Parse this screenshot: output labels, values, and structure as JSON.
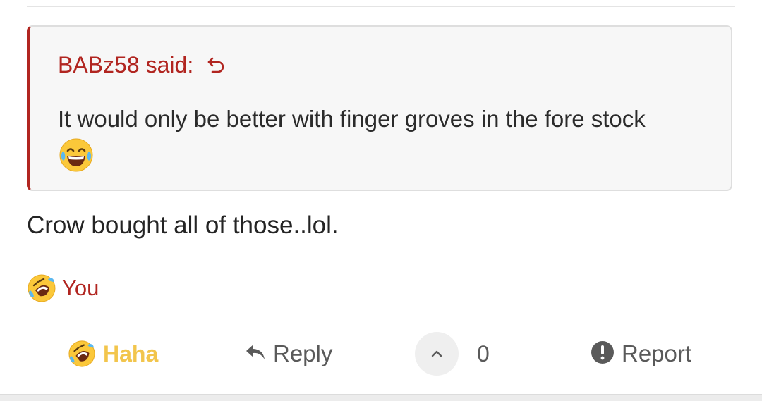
{
  "quote": {
    "author": "BABz58",
    "said": "said:",
    "text": "It would only be better with finger groves in the fore stock",
    "emoji_icon": "face-with-tears-of-joy-icon"
  },
  "message": {
    "text": "Crow bought all of those..lol."
  },
  "reactions": {
    "icon": "rolling-on-floor-laughing-icon",
    "who": "You"
  },
  "actions": {
    "haha": "Haha",
    "reply": "Reply",
    "vote_count": "0",
    "report": "Report"
  },
  "colors": {
    "accent": "#b12520",
    "haha": "#f2c54c",
    "muted": "#5a5a5a",
    "quote_bg": "#f7f7f7"
  }
}
